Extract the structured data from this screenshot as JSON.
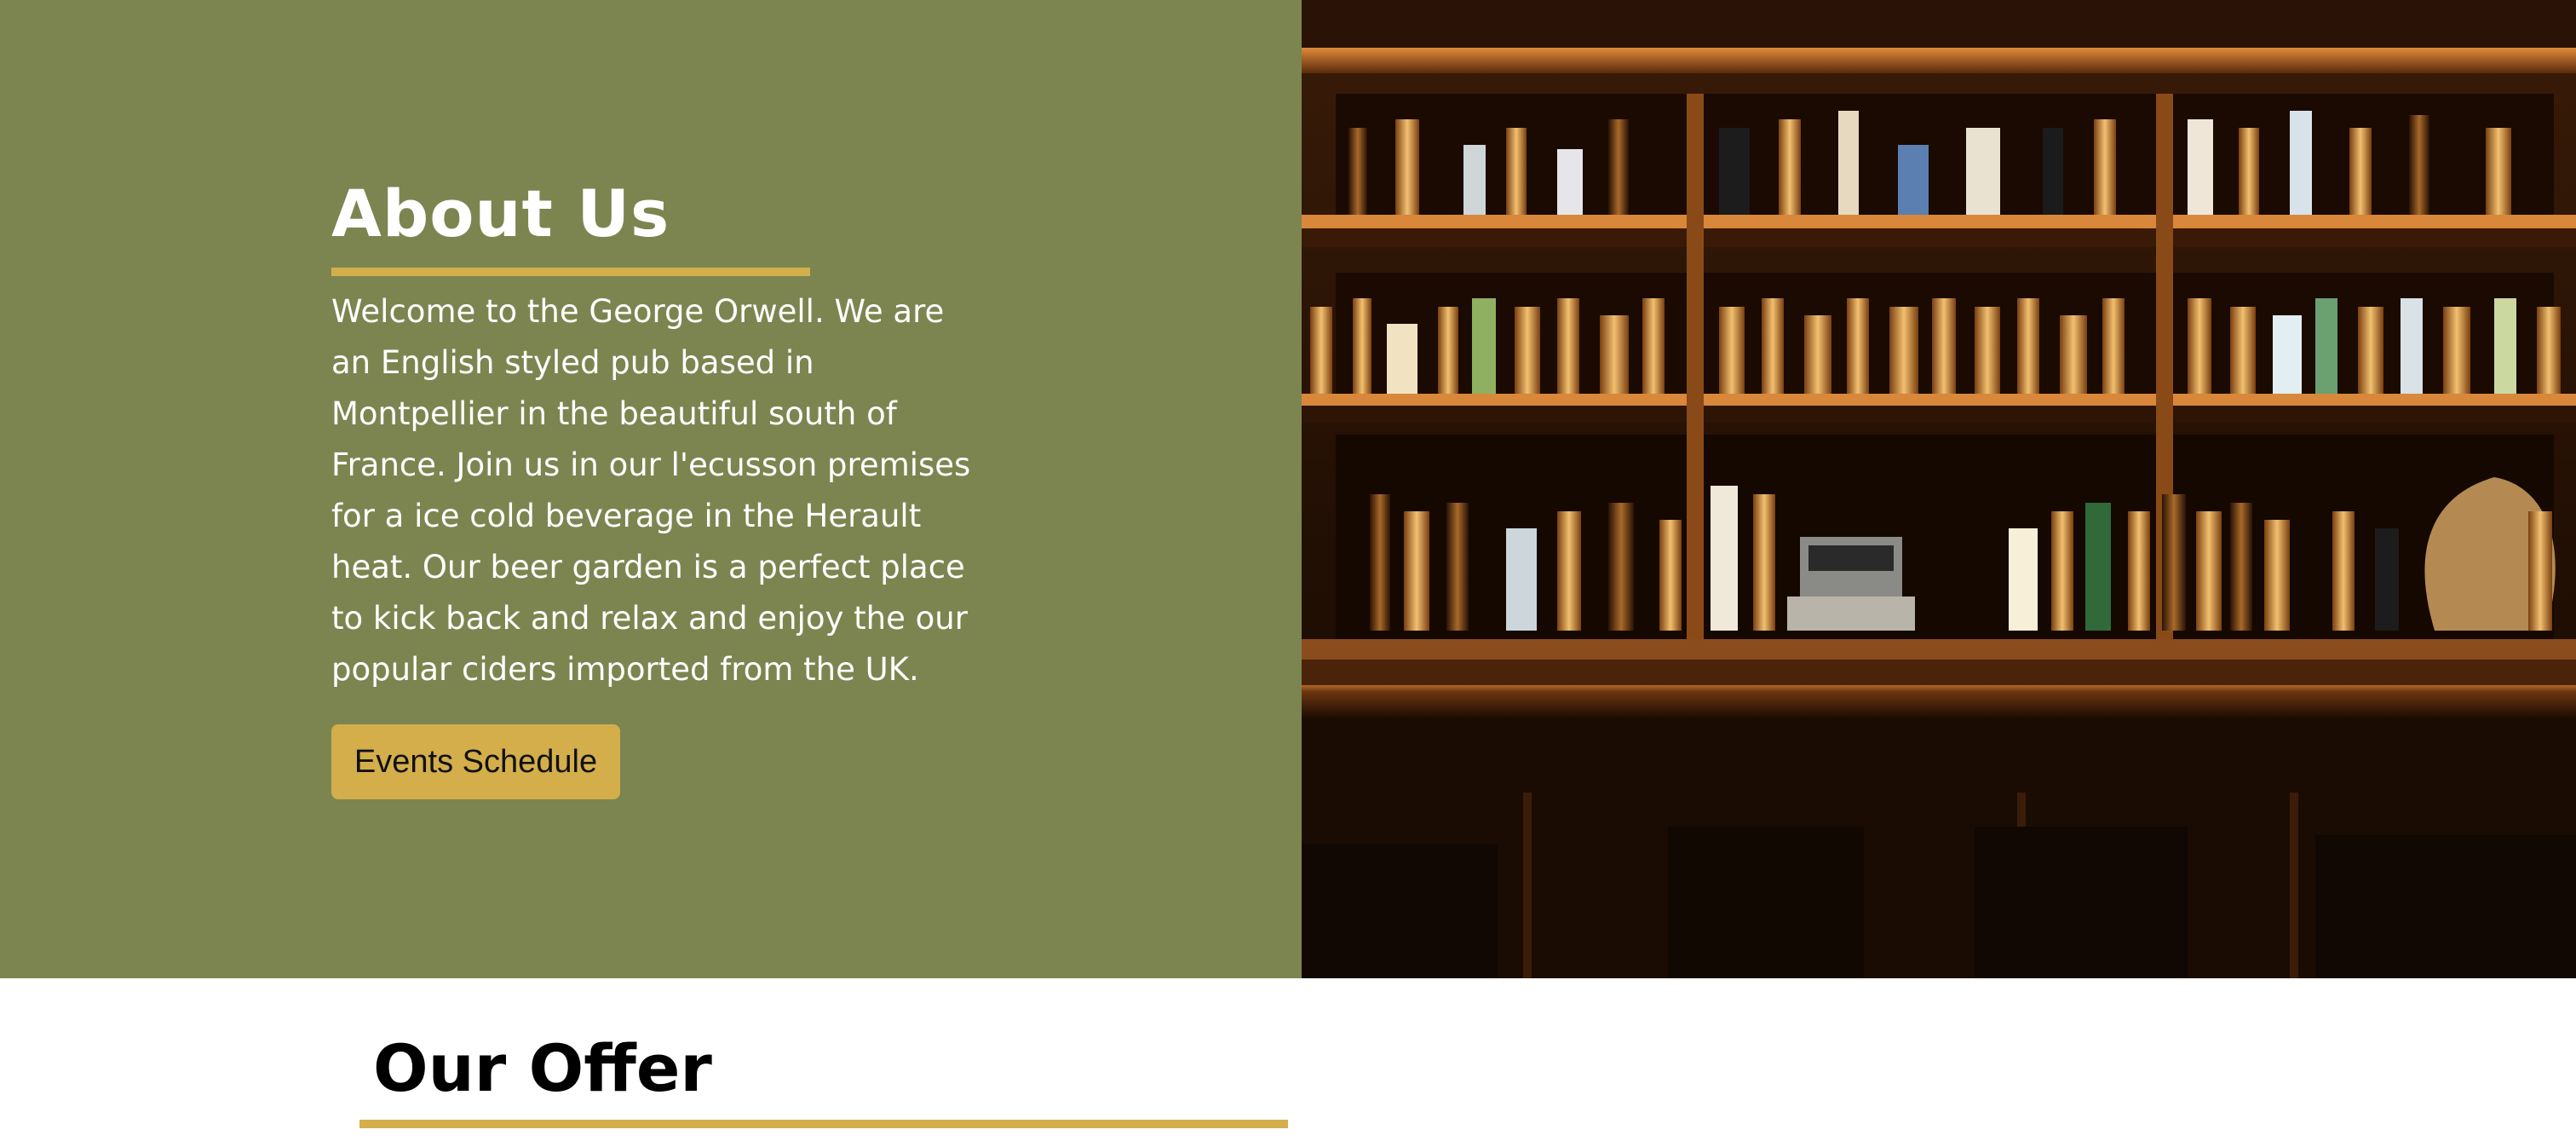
{
  "about": {
    "title": "About Us",
    "body": "Welcome to the George Orwell. We are an English styled pub based in Montpellier in the beautiful south of France. Join us in our l'ecusson premises for a ice cold beverage in the Herault heat. Our beer garden is a perfect place to kick back and relax and enjoy the our popular ciders imported from the UK.",
    "button_label": "Events Schedule",
    "image_description": "bar-shelves-photo"
  },
  "offer": {
    "title": "Our Offer"
  },
  "colors": {
    "about_background": "#7c8550",
    "accent": "#d3ae4b",
    "heading_dark": "#000000",
    "text_light": "#ffffff"
  }
}
